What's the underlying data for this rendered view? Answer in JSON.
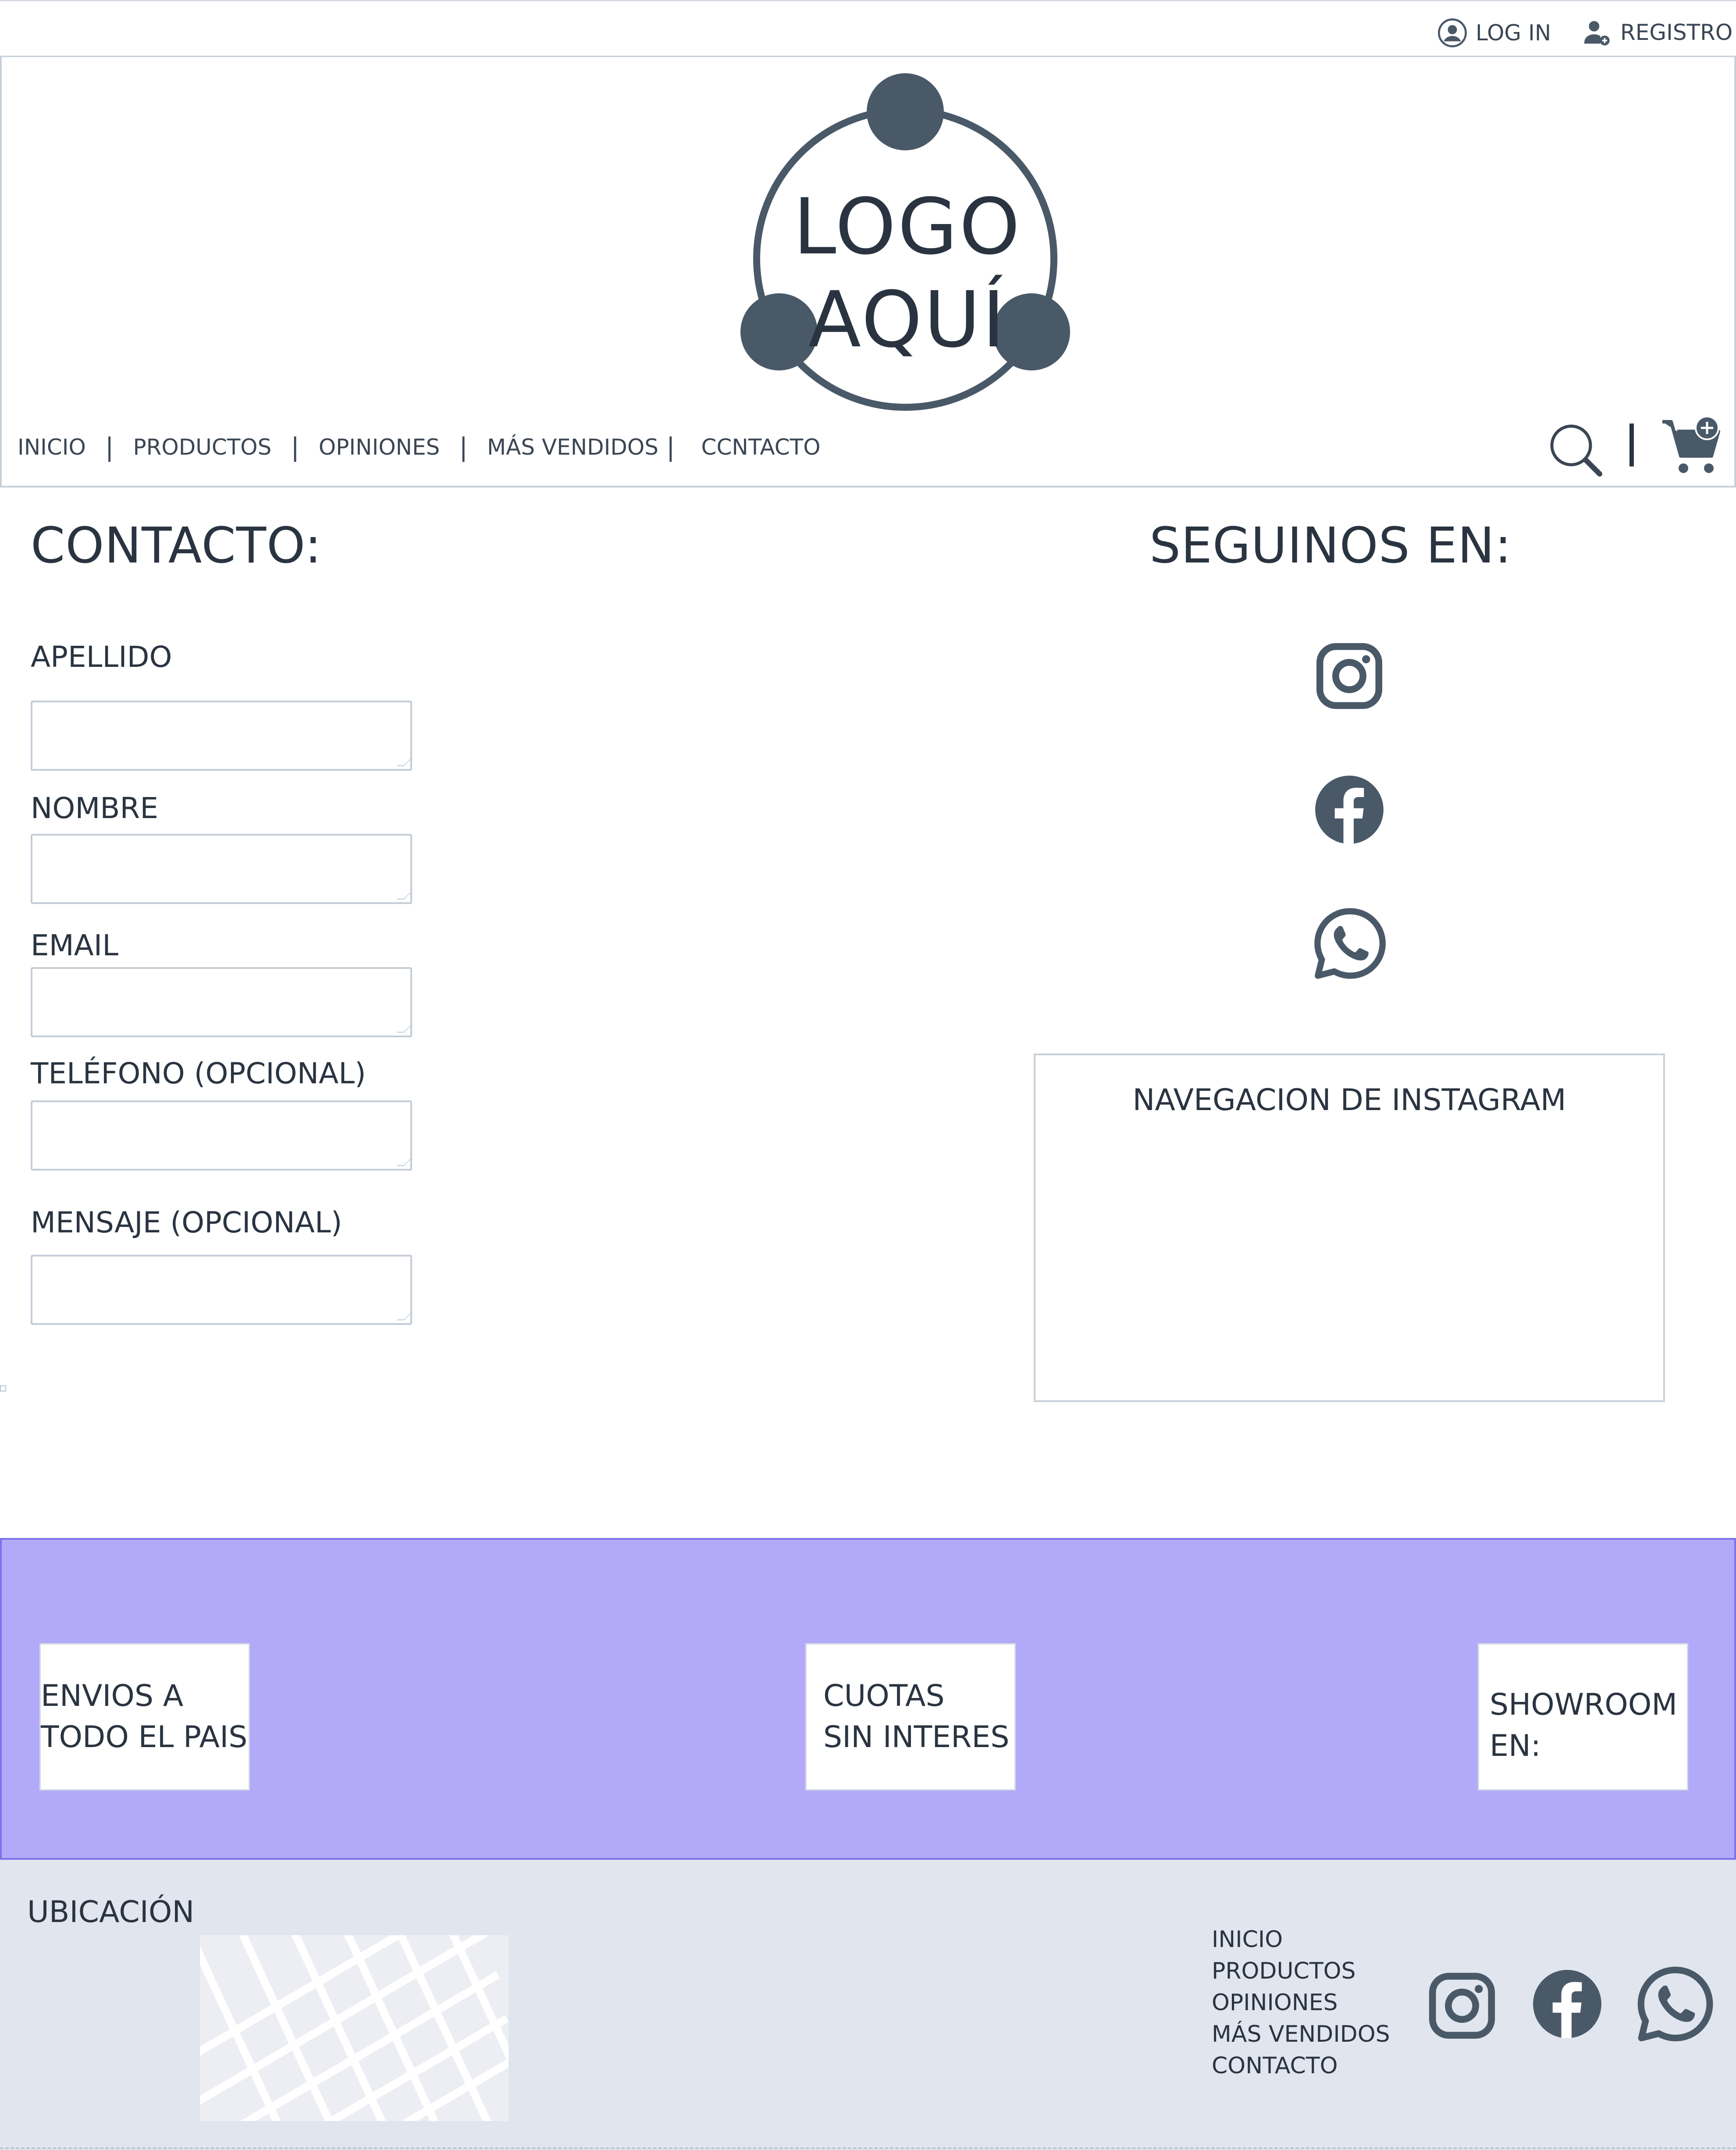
{
  "topbar": {
    "login_label": "LOG IN",
    "register_label": "REGISTRO"
  },
  "logo": {
    "line1": "LOGO",
    "line2": "AQUÍ"
  },
  "nav": {
    "items": [
      "INICIO",
      "PRODUCTOS",
      "OPINIONES",
      "MÁS VENDIDOS",
      "CCNTACTO"
    ],
    "separator": "|"
  },
  "icons": {
    "user": "user-circle-icon",
    "register": "user-add-icon",
    "search": "search-icon",
    "cart": "cart-add-icon",
    "instagram": "instagram-icon",
    "facebook": "facebook-icon",
    "whatsapp": "whatsapp-icon"
  },
  "contact": {
    "title": "CONTACTO:",
    "fields": [
      {
        "label": "APELLIDO",
        "value": ""
      },
      {
        "label": "NOMBRE",
        "value": ""
      },
      {
        "label": "EMAIL",
        "value": ""
      },
      {
        "label": "TELÉFONO (OPCIONAL)",
        "value": ""
      },
      {
        "label": "MENSAJE (OPCIONAL)",
        "value": ""
      }
    ]
  },
  "social": {
    "title": "SEGUINOS EN:",
    "instagram_box_title": "NAVEGACION DE INSTAGRAM"
  },
  "features": [
    {
      "line1": "ENVIOS A",
      "line2": "TODO EL PAIS"
    },
    {
      "line1": "CUOTAS",
      "line2": "SIN INTERES"
    },
    {
      "line1": "SHOWROOM",
      "line2": "EN:"
    }
  ],
  "footer": {
    "location_label": "UBICACIÓN",
    "links": [
      "INICIO",
      "PRODUCTOS",
      "OPINIONES",
      "MÁS VENDIDOS",
      "CONTACTO"
    ]
  },
  "colors": {
    "icon_dark": "#4a5968",
    "band_bg": "#b2aaf8",
    "band_border": "#7d73ea",
    "footer_bg": "#e0e5ee",
    "text": "#2a3441"
  }
}
